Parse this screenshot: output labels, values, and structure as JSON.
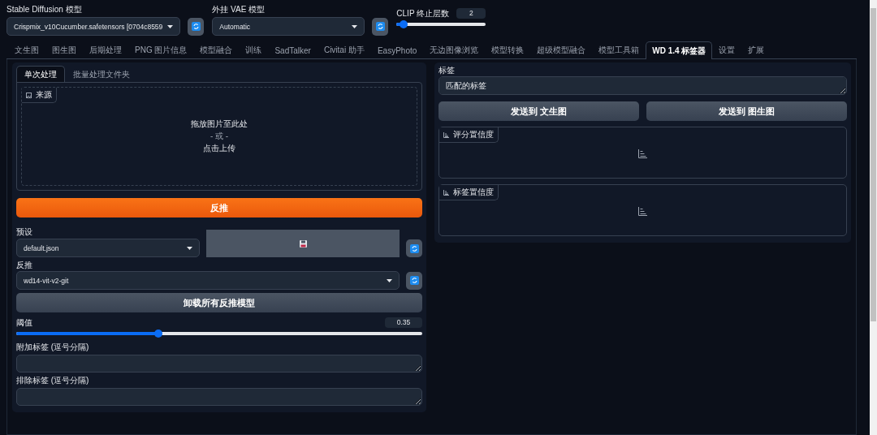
{
  "models": [
    {
      "label": "Stable Diffusion 模型",
      "value": "Crispmix_v10Cucumber.safetensors [0704c8559"
    },
    {
      "label": "外挂 VAE 模型",
      "value": "Automatic"
    }
  ],
  "clip": {
    "label": "CLIP 终止层数",
    "value": "2",
    "level": 0.08
  },
  "tabs": [
    {
      "label": "文生图",
      "selected": false
    },
    {
      "label": "图生图",
      "selected": false
    },
    {
      "label": "后期处理",
      "selected": false
    },
    {
      "label": "PNG 图片信息",
      "selected": false
    },
    {
      "label": "模型融合",
      "selected": false
    },
    {
      "label": "训练",
      "selected": false
    },
    {
      "label": "SadTalker",
      "selected": false
    },
    {
      "label": "Civitai 助手",
      "selected": false
    },
    {
      "label": "EasyPhoto",
      "selected": false
    },
    {
      "label": "无边图像浏览",
      "selected": false
    },
    {
      "label": "模型转换",
      "selected": false
    },
    {
      "label": "超级模型融合",
      "selected": false
    },
    {
      "label": "模型工具箱",
      "selected": false
    },
    {
      "label": "WD 1.4 标签器",
      "selected": true
    },
    {
      "label": "设置",
      "selected": false
    },
    {
      "label": "扩展",
      "selected": false
    }
  ],
  "subtabs": [
    {
      "label": "单次处理",
      "selected": true
    },
    {
      "label": "批量处理文件夹",
      "selected": false
    }
  ],
  "source": {
    "label": "来源",
    "drop": "拖放图片至此处",
    "or": "- 或 -",
    "click": "点击上传"
  },
  "interrogate_button": "反推",
  "preset": {
    "label": "预设",
    "value": "default.json"
  },
  "interrogator": {
    "label": "反推",
    "value": "wd14-vit-v2-git"
  },
  "unload_button": "卸载所有反推模型",
  "threshold": {
    "label": "阈值",
    "value": "0.35",
    "level": 0.35
  },
  "text_fields": [
    {
      "label": "附加标签 (逗号分隔)"
    },
    {
      "label": "排除标签 (逗号分隔)"
    }
  ],
  "tags": {
    "label": "标签",
    "placeholder": "匹配的标签"
  },
  "send_buttons": [
    "发送到 文生图",
    "发送到 图生图"
  ],
  "confidence_panels": [
    {
      "label": "评分置信度"
    },
    {
      "label": "标签置信度"
    }
  ]
}
